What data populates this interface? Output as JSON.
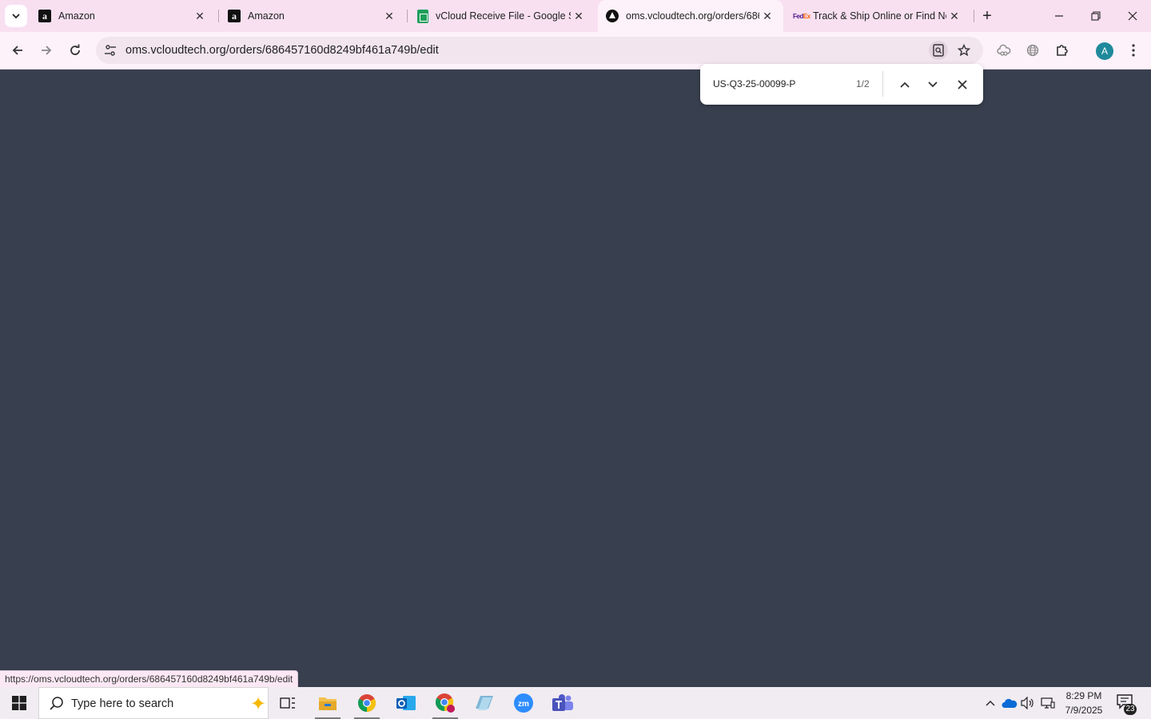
{
  "browser": {
    "tabs": [
      {
        "title": "Amazon",
        "favicon": "amazon-icon",
        "active": false
      },
      {
        "title": "Amazon",
        "favicon": "amazon-icon",
        "active": false
      },
      {
        "title": "vCloud Receive File - Google Sh",
        "favicon": "google-sheets-icon",
        "active": false
      },
      {
        "title": "oms.vcloudtech.org/orders/686",
        "favicon": "oms-icon",
        "active": true
      },
      {
        "title": "Track & Ship Online or Find Ne",
        "favicon": "fedex-icon",
        "active": false
      }
    ],
    "url": "oms.vcloudtech.org/orders/686457160d8249bf461a749b/edit",
    "avatar_letter": "A"
  },
  "find_bar": {
    "query": "US-Q3-25-00099-P",
    "match_count": "1/2"
  },
  "status_url": "https://oms.vcloudtech.org/orders/686457160d8249bf461a749b/edit",
  "taskbar": {
    "search_placeholder": "Type here to search",
    "time": "8:29 PM",
    "date": "7/9/2025",
    "notification_count": "23"
  },
  "colors": {
    "page_background": "#38404f",
    "tabstrip": "#f8e0f1",
    "toolbar": "#fdf2f9"
  }
}
